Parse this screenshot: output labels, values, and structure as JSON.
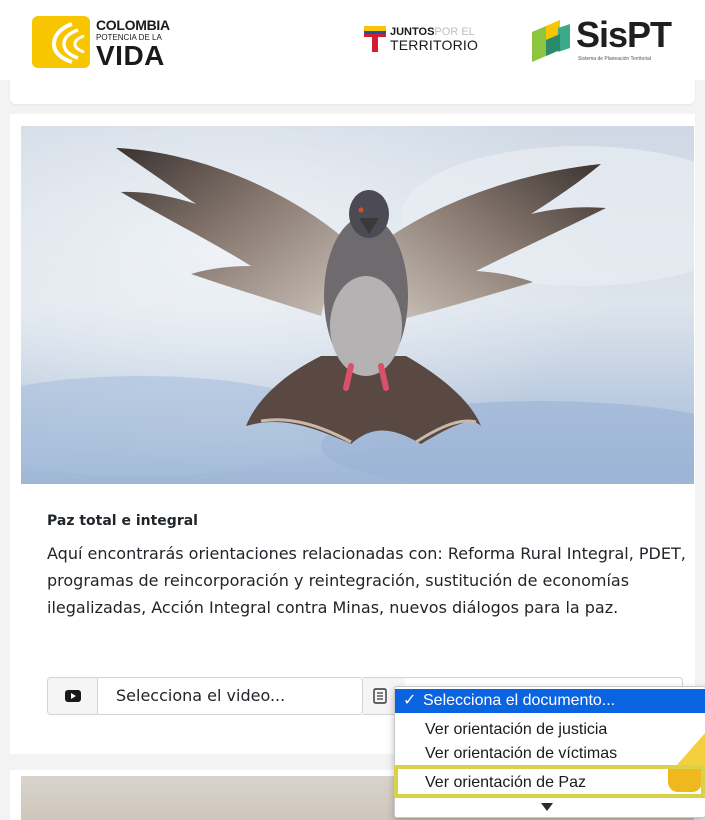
{
  "header": {
    "logo_colombia": {
      "line1": "COLOMBIA",
      "line2": "POTENCIA DE LA",
      "line3": "VIDA",
      "color": "#f7c600"
    },
    "logo_juntos": {
      "bold": "JUNTOS",
      "light": "POR EL",
      "line2": "TERRITORIO"
    },
    "logo_sispt": {
      "name": "SisPT",
      "subtitle": "Sistema de Planeación Territorial"
    }
  },
  "card": {
    "image": "pigeon-in-flight-photo",
    "title": "Paz total e integral",
    "description": "Aquí encontrarás orientaciones relacionadas con: Reforma Rural Integral, PDET, programas de reincorporación y reintegración, sustitución de economías ilegalizadas, Acción Integral contra Minas, nuevos diálogos para la paz.",
    "video_select": {
      "icon": "youtube-icon",
      "value": "Selecciona el video..."
    },
    "document_select": {
      "icon": "document-icon",
      "options": [
        "Selecciona el documento...",
        "Ver orientación de justicia",
        "Ver orientación de víctimas",
        "Ver orientación de Paz"
      ],
      "selected_index": 0,
      "highlighted_index": 3,
      "check_glyph": "✓"
    }
  },
  "colors": {
    "selected": "#0a64e2",
    "highlight": "#d9d147",
    "accent": "#f0b81f"
  }
}
